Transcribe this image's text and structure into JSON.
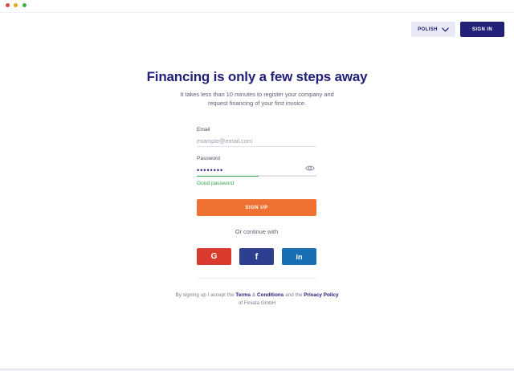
{
  "header": {
    "language_label": "POLISH",
    "signin_label": "SIGN IN"
  },
  "hero": {
    "title": "Financing is only a few steps away",
    "subtitle": "It takes less than 10 minutes to register your company and request financing of your first invoice."
  },
  "form": {
    "email_label": "Email",
    "email_value": "",
    "email_placeholder": "example@email.com",
    "password_label": "Password",
    "password_value": "••••••••",
    "password_strength_text": "Good password",
    "password_strength_fraction": 0.52,
    "signup_label": "SIGN UP"
  },
  "social": {
    "or_text": "Or continue with",
    "google_label": "G",
    "facebook_label": "f",
    "linkedin_label": "in"
  },
  "terms": {
    "prefix": "By signing up I accept the",
    "terms_link": "Terms",
    "amp": "&",
    "conditions_link": "Conditions",
    "and_text": "and the",
    "privacy_link": "Privacy Policy",
    "suffix": "of Finiata GmbH"
  },
  "colors": {
    "brand_navy": "#23207a",
    "signup_orange": "#f07232",
    "google_red": "#d93a2e",
    "facebook_blue": "#2f3f8f",
    "linkedin_blue": "#1a6fb4",
    "success_green": "#2fa24a"
  },
  "icons": {
    "language_chevron": "chevron-down-icon",
    "password_visibility": "eye-icon"
  }
}
